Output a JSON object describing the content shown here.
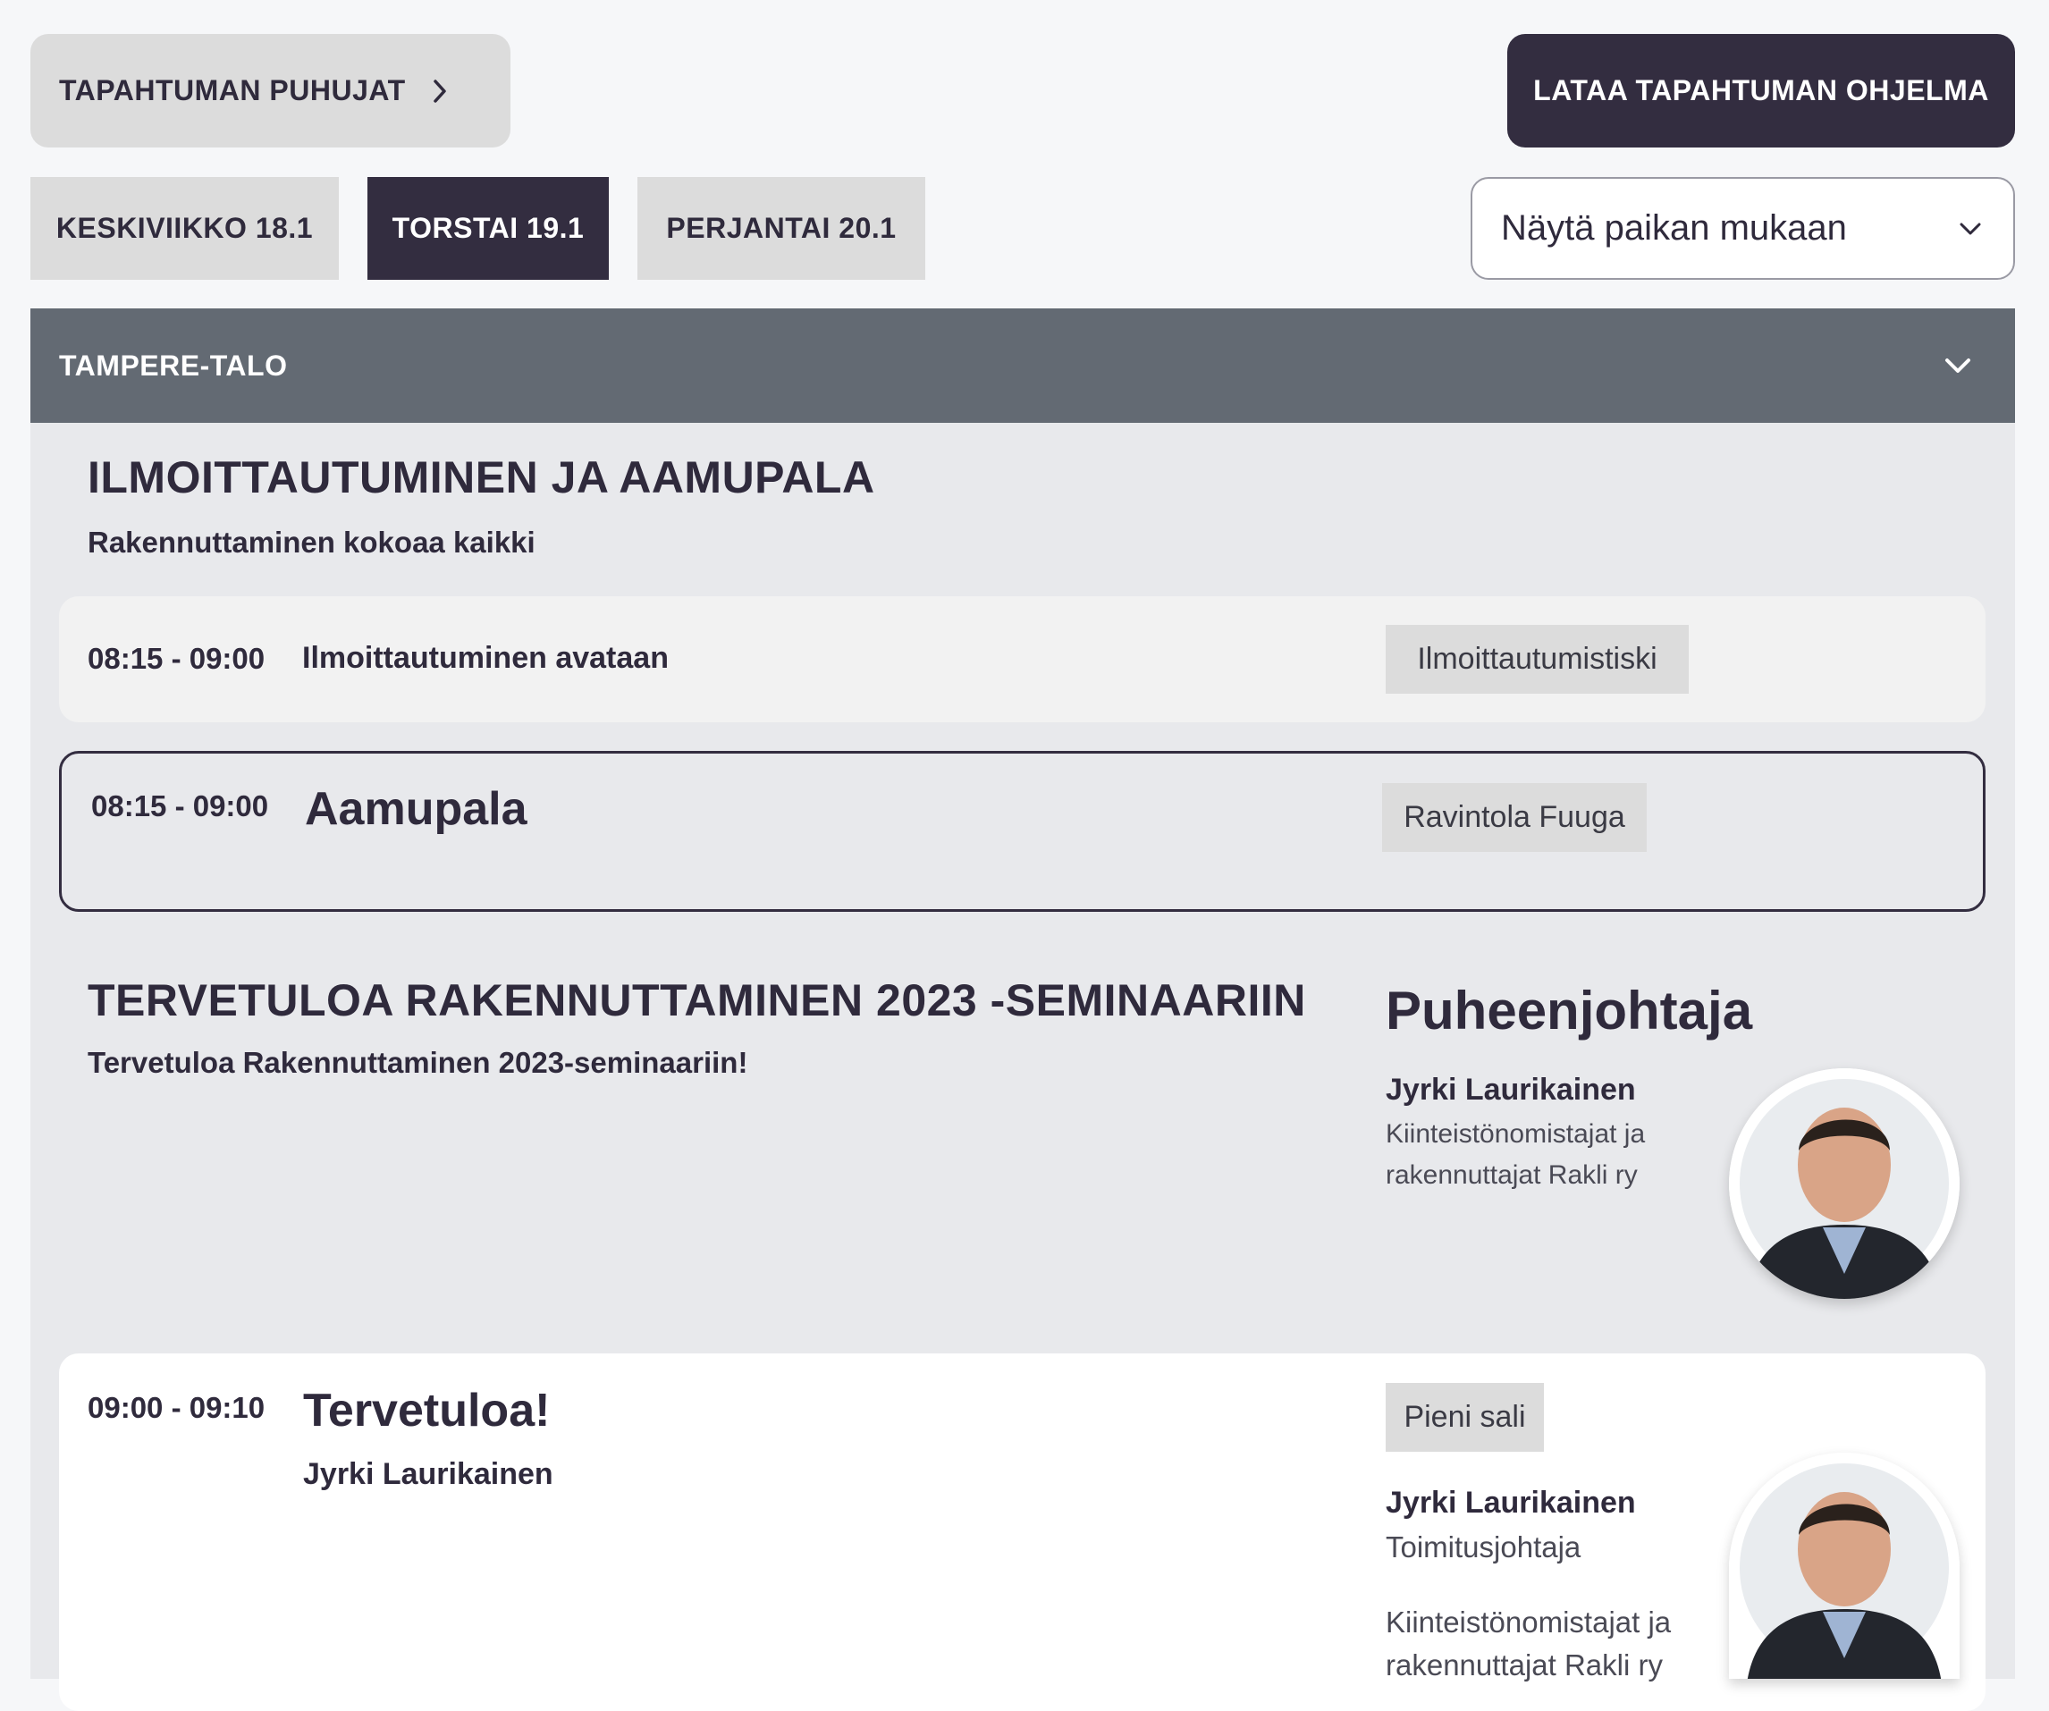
{
  "top": {
    "speakers_label": "TAPAHTUMAN PUHUJAT",
    "download_label": "LATAA TAPAHTUMAN OHJELMA"
  },
  "days": [
    {
      "label": "KESKIVIIKKO 18.1",
      "active": false
    },
    {
      "label": "TORSTAI 19.1",
      "active": true
    },
    {
      "label": "PERJANTAI 20.1",
      "active": false
    }
  ],
  "place_select": {
    "value": "Näytä paikan mukaan"
  },
  "venue": {
    "name": "TAMPERE-TALO"
  },
  "sections": [
    {
      "title": "ILMOITTAUTUMINEN JA AAMUPALA",
      "subtitle": "Rakennuttaminen kokoaa kaikki",
      "events": [
        {
          "time": "08:15 - 09:00",
          "title": "Ilmoittautuminen avataan",
          "location": "Ilmoittautumistiski"
        },
        {
          "time": "08:15 - 09:00",
          "title": "Aamupala",
          "location": "Ravintola Fuuga"
        }
      ]
    },
    {
      "title": "TERVETULOA RAKENNUTTAMINEN 2023 -SEMINAARIIN",
      "subtitle": "Tervetuloa Rakennuttaminen 2023-seminaariin!",
      "chair": {
        "heading": "Puheenjohtaja",
        "name": "Jyrki Laurikainen",
        "org_line1": "Kiinteistönomistajat ja",
        "org_line2": "rakennuttajat Rakli ry"
      },
      "events": [
        {
          "time": "09:00 - 09:10",
          "title": "Tervetuloa!",
          "speaker_line": "Jyrki Laurikainen",
          "location": "Pieni sali",
          "speaker": {
            "name": "Jyrki Laurikainen",
            "role": "Toimitusjohtaja",
            "org_line1": "Kiinteistönomistajat ja",
            "org_line2": "rakennuttajat Rakli ry"
          }
        }
      ]
    }
  ],
  "colors": {
    "dark": "#332d40",
    "venue_bar": "#636a73",
    "tab_bg": "#dcdcdc",
    "panel_bg": "#e8e9ec"
  },
  "icons": [
    "chevron-right-icon",
    "chevron-down-icon"
  ]
}
